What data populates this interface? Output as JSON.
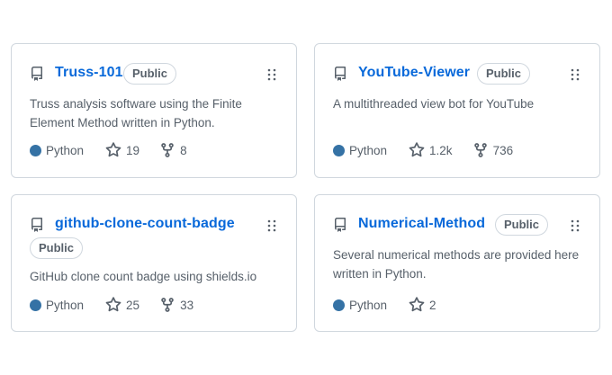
{
  "colors": {
    "link": "#0969da",
    "python": "#3572A5",
    "muted": "#57606a",
    "border": "#d0d7de"
  },
  "icons": {
    "repo": "repo-icon",
    "drag": "grabber-icon",
    "star": "star-icon",
    "fork": "fork-icon"
  },
  "repos": [
    {
      "name": "Truss-101",
      "visibility": "Public",
      "description": "Truss analysis software using the Finite Element Method written in Python.",
      "language": "Python",
      "stars": "19",
      "forks": "8"
    },
    {
      "name": "YouTube-Viewer",
      "visibility": "Public",
      "description": "A multithreaded view bot for YouTube",
      "language": "Python",
      "stars": "1.2k",
      "forks": "736"
    },
    {
      "name": "github-clone-count-badge",
      "visibility": "Public",
      "description": "GitHub clone count badge using shields.io",
      "language": "Python",
      "stars": "25",
      "forks": "33"
    },
    {
      "name": "Numerical-Method",
      "visibility": "Public",
      "description": "Several numerical methods are provided here written in Python.",
      "language": "Python",
      "stars": "2",
      "forks": ""
    }
  ]
}
